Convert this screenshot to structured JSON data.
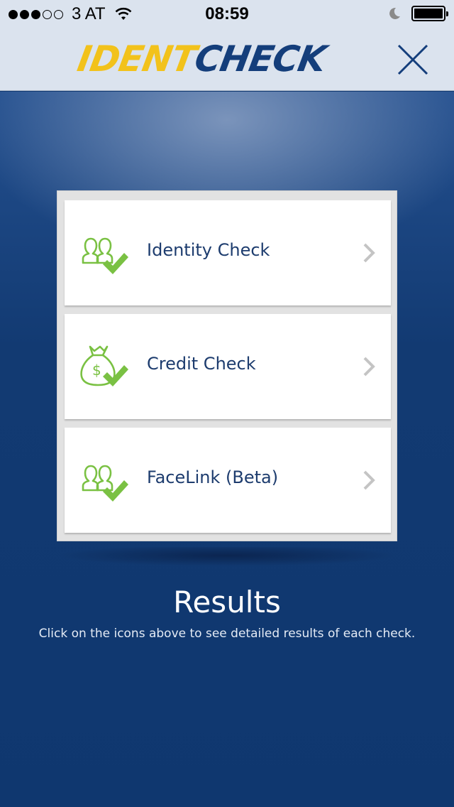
{
  "status_bar": {
    "carrier": "3 AT",
    "time": "08:59",
    "signal_bars_on": 3,
    "signal_bars_total": 5
  },
  "header": {
    "logo_part1": "IDENT",
    "logo_part2": "CHECK",
    "close_icon": "close-icon"
  },
  "checks": [
    {
      "label": "Identity Check",
      "icon": "people-check-icon"
    },
    {
      "label": "Credit Check",
      "icon": "money-bag-check-icon"
    },
    {
      "label": "FaceLink (Beta)",
      "icon": "people-check-icon"
    }
  ],
  "results": {
    "title": "Results",
    "subtitle": "Click on the icons above to see detailed results of each check."
  },
  "colors": {
    "logo_yellow": "#f2c21b",
    "logo_blue": "#143e7b",
    "icon_green": "#7ac143",
    "label_blue": "#1d3c6e",
    "background_blue": "#123a72"
  }
}
